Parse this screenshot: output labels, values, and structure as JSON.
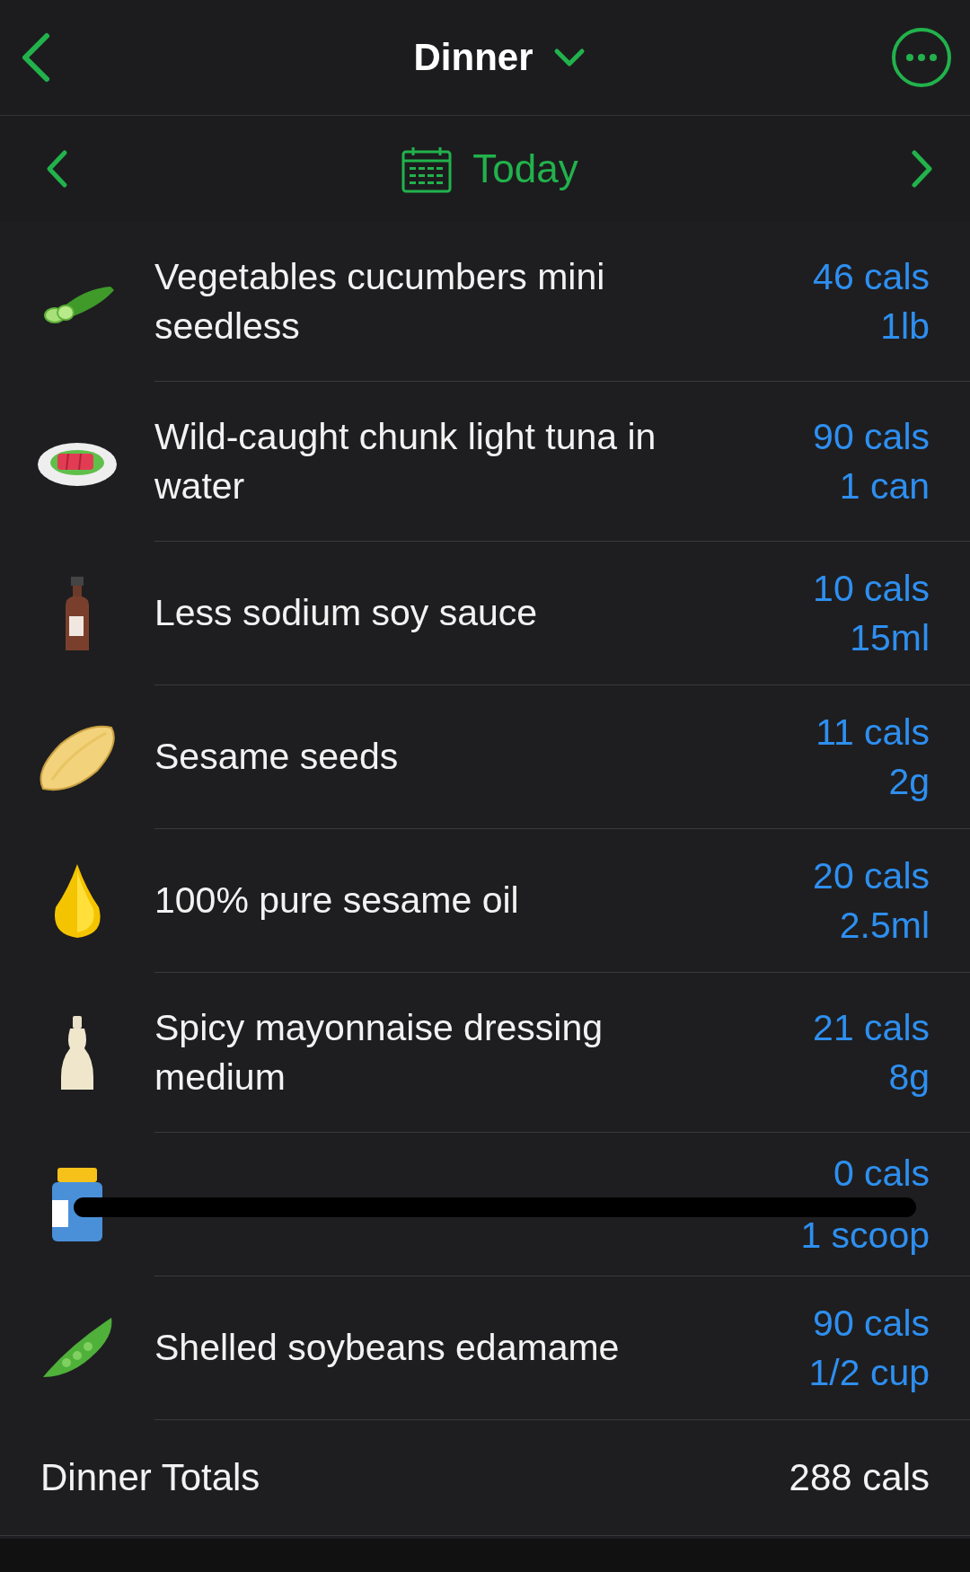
{
  "header": {
    "title": "Dinner"
  },
  "date_nav": {
    "label": "Today"
  },
  "entries": [
    {
      "name": "Vegetables cucumbers mini seedless",
      "calories": "46 cals",
      "serving": "1lb",
      "redacted": false
    },
    {
      "name": "Wild-caught chunk light tuna in water",
      "calories": "90 cals",
      "serving": "1 can",
      "redacted": false
    },
    {
      "name": "Less sodium soy sauce",
      "calories": "10 cals",
      "serving": "15ml",
      "redacted": false
    },
    {
      "name": "Sesame seeds",
      "calories": "11 cals",
      "serving": "2g",
      "redacted": false
    },
    {
      "name": "100% pure sesame oil",
      "calories": "20 cals",
      "serving": "2.5ml",
      "redacted": false
    },
    {
      "name": "Spicy mayonnaise dressing medium",
      "calories": "21 cals",
      "serving": "8g",
      "redacted": false
    },
    {
      "calories": "0 cals",
      "serving": "1 scoop",
      "redacted": true
    },
    {
      "name": "Shelled soybeans edamame",
      "calories": "90 cals",
      "serving": "1/2 cup",
      "redacted": false
    }
  ],
  "totals": {
    "label": "Dinner Totals",
    "value": "288 cals"
  }
}
